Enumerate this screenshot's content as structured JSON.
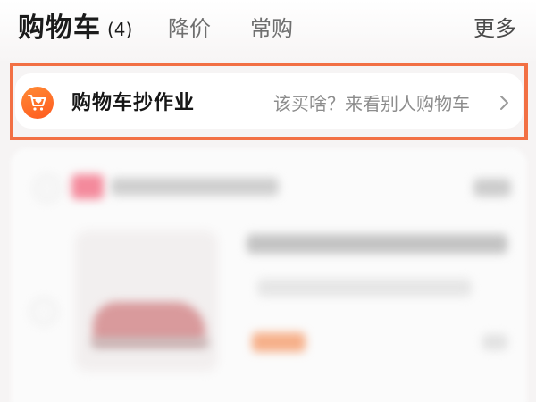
{
  "header": {
    "title": "购物车",
    "count": "(4)",
    "tabs": [
      {
        "label": "降价"
      },
      {
        "label": "常购"
      }
    ],
    "more_label": "更多"
  },
  "banner": {
    "icon": "cart-heart-icon",
    "title": "购物车抄作业",
    "subtitle": "该买啥？来看别人购物车",
    "arrow_icon": "chevron-right-icon",
    "highlight_color": "#f27044",
    "icon_color": "#ff6a2a"
  },
  "cart_item": {
    "shop_checkbox_icon": "radio-circle-icon",
    "item_checkbox_icon": "radio-circle-icon",
    "product_image_icon": "sneaker-image"
  }
}
